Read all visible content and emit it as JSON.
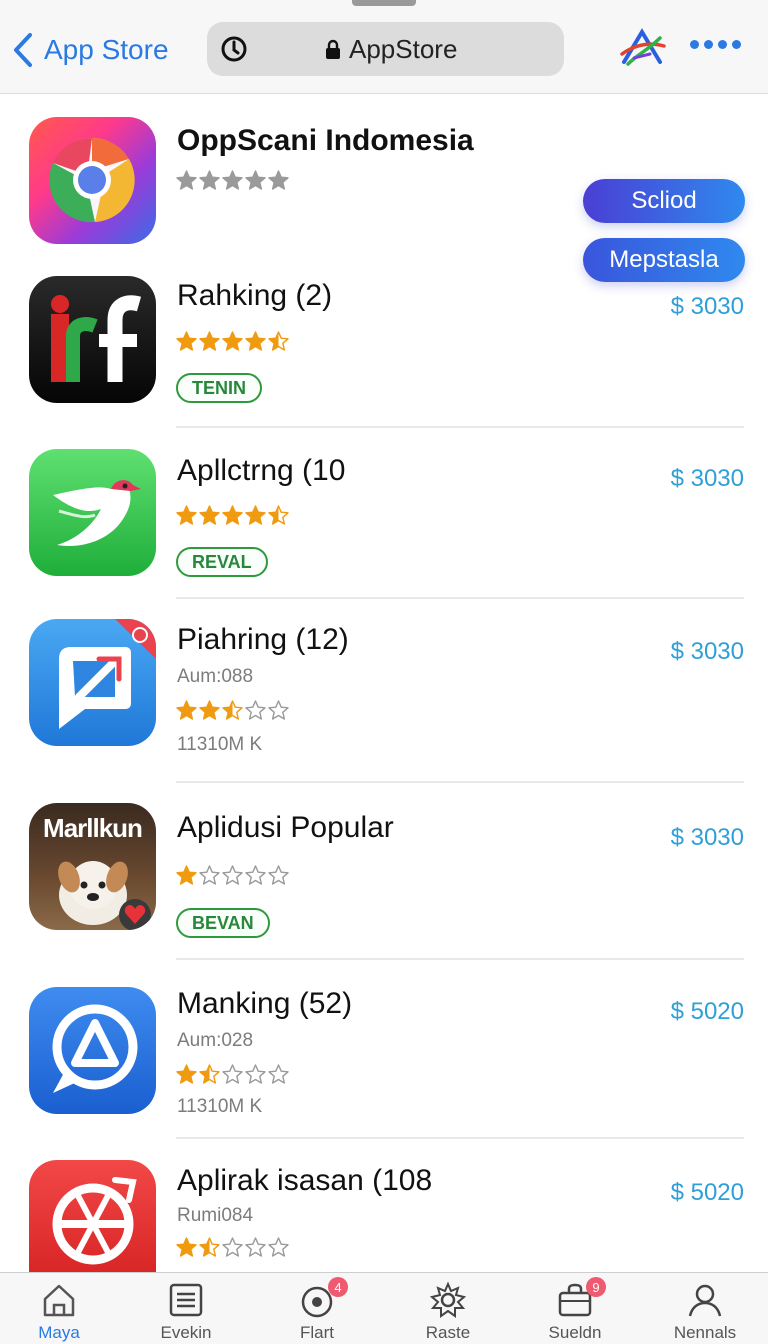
{
  "nav": {
    "back_label": "App Store",
    "url_text": "AppStore"
  },
  "colors": {
    "accent": "#2a7ae2",
    "price": "#2f9fd8",
    "badge": "#2f9a3c",
    "star": "#f09a10",
    "pill_start": "#3b4fd6",
    "pill_end": "#2f89ee"
  },
  "featured": {
    "name": "OppScani Indomesia",
    "rating": 0,
    "button_primary": "Scliod",
    "button_secondary": "Mepstasla"
  },
  "apps": [
    {
      "name": "Rahking (2)",
      "rating": 4.5,
      "badge": "TENIN",
      "price": "$ 3030",
      "icon": "rf-logo-icon"
    },
    {
      "name": "Apllctrng (10",
      "rating": 4.5,
      "badge": "REVAL",
      "price": "$ 3030",
      "icon": "bird-icon"
    },
    {
      "name": "Piahring (12)",
      "rating": 2.5,
      "subtitle": "Aum:088",
      "meta": "11310M K",
      "price": "$ 3030",
      "icon": "share-arrow-icon"
    },
    {
      "name": "Aplidusi Popular",
      "rating": 1,
      "badge": "BEVAN",
      "price": "$ 3030",
      "icon": "dog-photo-icon",
      "icon_text": "Marllkun"
    },
    {
      "name": "Manking (52)",
      "rating": 1.5,
      "subtitle": "Aum:028",
      "meta": "11310M K",
      "price": "$ 5020",
      "icon": "chat-triangle-icon"
    },
    {
      "name": "Aplirak isasan (108",
      "rating": 1.5,
      "subtitle": "Rumi084",
      "price": "$ 5020",
      "icon": "compass-icon"
    }
  ],
  "tabs": [
    {
      "label": "Maya",
      "icon": "home-icon",
      "active": true
    },
    {
      "label": "Evekin",
      "icon": "list-icon"
    },
    {
      "label": "Flart",
      "icon": "target-icon",
      "badge": "4"
    },
    {
      "label": "Raste",
      "icon": "gear-flower-icon"
    },
    {
      "label": "Sueldn",
      "icon": "bag-icon",
      "badge": "9"
    },
    {
      "label": "Nennals",
      "icon": "person-icon"
    }
  ]
}
